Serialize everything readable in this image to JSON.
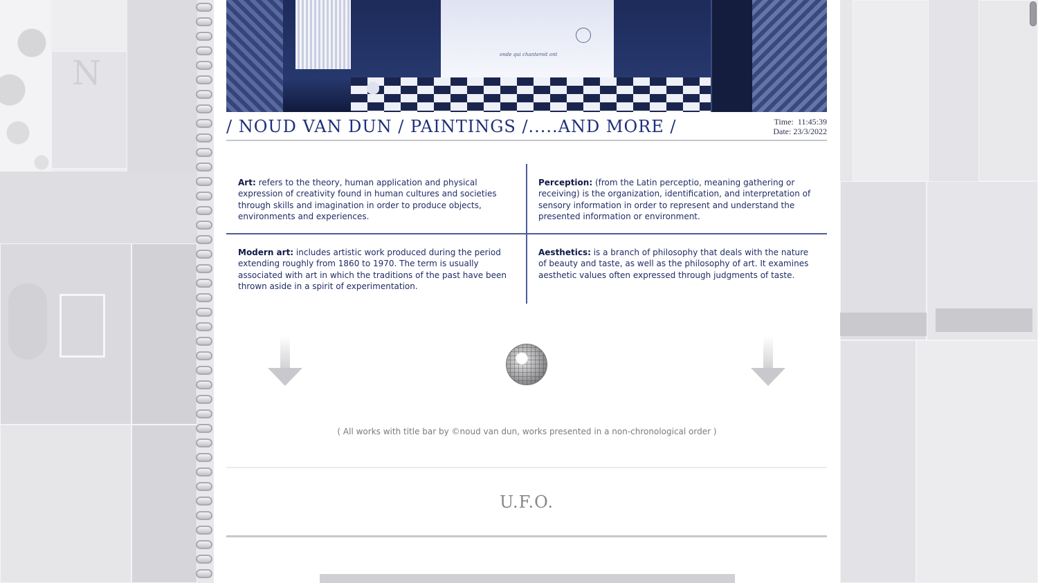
{
  "header": {
    "title": "/ NOUD VAN DUN / PAINTINGS /.....AND MORE /",
    "time_label": "Time:",
    "time_value": "11:45:39",
    "date_label": "Date:",
    "date_value": "23/3/2022"
  },
  "banner": {
    "sea_caption": "onde qui chanteroit ont"
  },
  "definitions": [
    {
      "term": "Art:",
      "text": " refers to the theory, human application and physical expression of creativity found in human cultures and societies through skills and imagination in order to produce objects, environments and experiences."
    },
    {
      "term": "Perception:",
      "text": " (from the Latin perceptio, meaning gathering or receiving) is the organization, identification, and interpretation of sensory information in order to represent and understand the presented information or environment."
    },
    {
      "term": "Modern art:",
      "text": " includes artistic work produced during the period extending roughly from 1860 to 1970. The term is usually associated with art in which the traditions of the past have been thrown aside in a spirit of experimentation."
    },
    {
      "term": "Aesthetics:",
      "text": " is a branch of philosophy that deals with the nature of beauty and taste, as well as the philosophy of art. It examines aesthetic values often expressed through judgments of taste."
    }
  ],
  "credit": "( All works with title bar by ©noud van dun, works presented in a non-chronological order )",
  "section": {
    "title": "U.F.O."
  },
  "background": {
    "letter": "N"
  },
  "colors": {
    "accent": "#1e2f7a",
    "divider": "#4b5b9c",
    "muted_text": "#7a7a82"
  },
  "icons": [
    "down-arrow-icon",
    "disco-ball-icon"
  ]
}
